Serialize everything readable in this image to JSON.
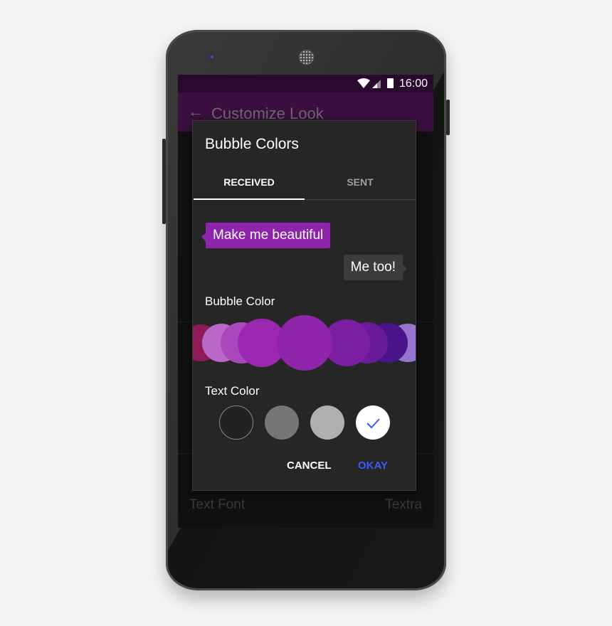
{
  "status_bar": {
    "time": "16:00",
    "icons": [
      "wifi-icon",
      "signal-icon",
      "battery-icon"
    ]
  },
  "toolbar": {
    "title": "Customize Look",
    "back_icon": "arrow-left-icon"
  },
  "background_list": {
    "text_font_label": "Text Font",
    "text_font_value": "Textra"
  },
  "dialog": {
    "title": "Bubble Colors",
    "tabs": [
      {
        "label": "RECEIVED",
        "selected": true
      },
      {
        "label": "SENT",
        "selected": false
      }
    ],
    "preview": {
      "received": "Make me beautiful",
      "sent": "Me too!"
    },
    "bubble_color_label": "Bubble Color",
    "bubble_colors": [
      "#8e1a5a",
      "#ba68c8",
      "#ab47bc",
      "#9c27b0",
      "#8e24aa",
      "#7b1fa2",
      "#6a1b9a",
      "#4a148c",
      "#9575cd"
    ],
    "selected_bubble_color": "#8e24aa",
    "text_color_label": "Text Color",
    "text_colors": [
      "#222222",
      "#757575",
      "#b0b0b0",
      "#ffffff"
    ],
    "selected_text_color": "#ffffff",
    "cancel": "CANCEL",
    "okay": "OKAY",
    "accent": "#3d5afe"
  }
}
